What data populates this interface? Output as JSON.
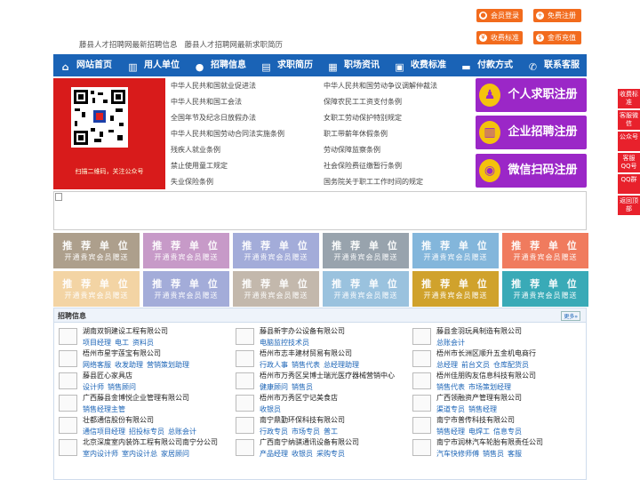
{
  "top_buttons": [
    {
      "label": "会员登录",
      "icon": "user-icon"
    },
    {
      "label": "免费注册",
      "icon": "register-icon"
    },
    {
      "label": "收费标准",
      "icon": "yuan-icon"
    },
    {
      "label": "金币充值",
      "icon": "coin-icon"
    }
  ],
  "slogans": [
    "藤县人才招聘网最新招聘信息",
    "藤县人才招聘网最新求职简历"
  ],
  "nav": [
    {
      "label": "网站首页",
      "icon": "home-icon"
    },
    {
      "label": "用人单位",
      "icon": "building-icon"
    },
    {
      "label": "招聘信息",
      "icon": "chat-icon"
    },
    {
      "label": "求职简历",
      "icon": "resume-icon"
    },
    {
      "label": "职场资讯",
      "icon": "news-icon"
    },
    {
      "label": "收费标准",
      "icon": "pricing-icon"
    },
    {
      "label": "付款方式",
      "icon": "payment-icon"
    },
    {
      "label": "联系客服",
      "icon": "phone-icon"
    }
  ],
  "qr_caption": "扫描二维码，关注公众号",
  "laws_left": [
    "中华人民共和国就业促进法",
    "中华人民共和国工会法",
    "全国年节及纪念日放假办法",
    "中华人民共和国劳动合同法实施条例",
    "残疾人就业条例",
    "禁止使用童工规定",
    "失业保险条例"
  ],
  "laws_right": [
    "中华人民共和国劳动争议调解仲裁法",
    "保障农民工工资支付条例",
    "女职工劳动保护特别规定",
    "职工带薪年休假条例",
    "劳动保障监察条例",
    "社会保险费征缴暂行条例",
    "国务院关于职工工作时间的规定"
  ],
  "register": [
    {
      "label": "个人求职注册",
      "icon": "person-icon"
    },
    {
      "label": "企业招聘注册",
      "icon": "company-icon"
    },
    {
      "label": "微信扫码注册",
      "icon": "wechat-icon"
    }
  ],
  "ads": {
    "title": "推 荐 单 位",
    "subtitle": "开通贵宾会员赠送"
  },
  "ad_colors": [
    "#ad9f8c",
    "#c79ac8",
    "#a3acd9",
    "#98a3ad",
    "#83b6db",
    "#f07b5e",
    "#f3d4a4",
    "#a3acd9",
    "#c3b8ac",
    "#9ac2de",
    "#d0a22c",
    "#39aab7"
  ],
  "jobs": {
    "title": "招聘信息",
    "more": "更多»",
    "items": [
      {
        "name": "湖南双铜建设工程有限公司",
        "posts": [
          "项目经理",
          "电工",
          "资料员"
        ]
      },
      {
        "name": "藤县新宇办公设备有限公司",
        "posts": [
          "电脑监控技术员"
        ]
      },
      {
        "name": "藤县金羽玩具制造有限公司",
        "posts": [
          "总账会计"
        ]
      },
      {
        "name": "梧州市星宇莲宝有限公司",
        "posts": [
          "网络客服",
          "收发助理",
          "营销策划助理"
        ]
      },
      {
        "name": "梧州市志丰建材贸易有限公司",
        "posts": [
          "行政人事",
          "销售代表",
          "总经理助理"
        ]
      },
      {
        "name": "梧州市长洲区顺升五金机电商行",
        "posts": [
          "总经理",
          "前台文员",
          "仓库配货员"
        ]
      },
      {
        "name": "藤县匠心家具店",
        "posts": [
          "设计师",
          "销售顾问"
        ]
      },
      {
        "name": "梧州市万秀区吴博士瑞光医疗器械营销中心",
        "posts": [
          "健康顾问",
          "销售员"
        ]
      },
      {
        "name": "梧州佳朋购友信息科技有限公司",
        "posts": [
          "销售代表",
          "市场策划经理"
        ]
      },
      {
        "name": "广西藤县金博悦企业管理有限公司",
        "posts": [
          "销售经理主管"
        ]
      },
      {
        "name": "梧州市万秀区宁记美食店",
        "posts": [
          "收银员"
        ]
      },
      {
        "name": "广西领融资产管理有限公司",
        "posts": [
          "渠道专员",
          "销售经理"
        ]
      },
      {
        "name": "壮都通信股份有限公司",
        "posts": [
          "通信项目经理",
          "招投标专员",
          "总账会计"
        ]
      },
      {
        "name": "南宁鼎勤环保科技有限公司",
        "posts": [
          "行政专员",
          "市场专员",
          "普工"
        ]
      },
      {
        "name": "南宁市普传科技有限公司",
        "posts": [
          "销售经理",
          "电焊工",
          "信息专员"
        ]
      },
      {
        "name": "北京深度室内装饰工程有限公司南宁分公司",
        "posts": [
          "室内设计师",
          "室内设计总",
          "家居顾问"
        ]
      },
      {
        "name": "广西南宁纳骐通讯设备有限公司",
        "posts": [
          "产品经理",
          "收银员",
          "采购专员"
        ]
      },
      {
        "name": "南宁市润林汽车轮胎有限责任公司",
        "posts": [
          "汽车快修师傅",
          "销售员",
          "客服"
        ]
      }
    ]
  },
  "side_buttons": [
    "收费标准",
    "客服微信",
    "公众号",
    "客服QQ号",
    "QQ群",
    "返回顶部"
  ]
}
